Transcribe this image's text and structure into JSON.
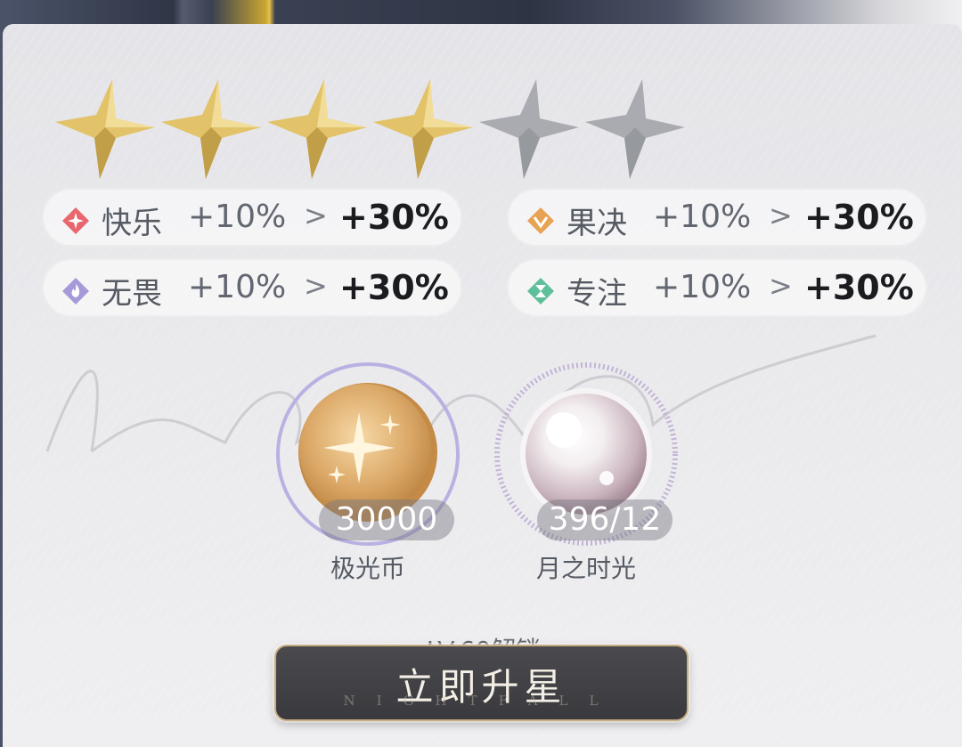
{
  "star_rating": {
    "filled": 4,
    "total": 6
  },
  "stats": [
    {
      "name": "快乐",
      "from": "+10%",
      "to": "+30%",
      "arrow": ">",
      "gem_color": "#e8676f",
      "icon": "sparkle-gem-icon"
    },
    {
      "name": "果决",
      "from": "+10%",
      "to": "+30%",
      "arrow": ">",
      "gem_color": "#e7a252",
      "icon": "shield-gem-icon"
    },
    {
      "name": "无畏",
      "from": "+10%",
      "to": "+30%",
      "arrow": ">",
      "gem_color": "#a79ad8",
      "icon": "flame-gem-icon"
    },
    {
      "name": "专注",
      "from": "+10%",
      "to": "+30%",
      "arrow": ">",
      "gem_color": "#5fbf9a",
      "icon": "hourglass-gem-icon"
    }
  ],
  "costs": [
    {
      "label": "极光币",
      "quantity": "30000",
      "icon": "aurora-coin-icon"
    },
    {
      "label": "月之时光",
      "quantity": "396/12",
      "icon": "moon-pearl-icon"
    }
  ],
  "unlock_text": "LV.60解锁",
  "upgrade_button": {
    "label": "立即升星",
    "sub": "NIGHTFALL"
  },
  "colors": {
    "gold_star": "#e2c36a",
    "empty_star": "#a9abb0",
    "button_bg": "#3f3f43",
    "button_border": "#c9ae82"
  }
}
